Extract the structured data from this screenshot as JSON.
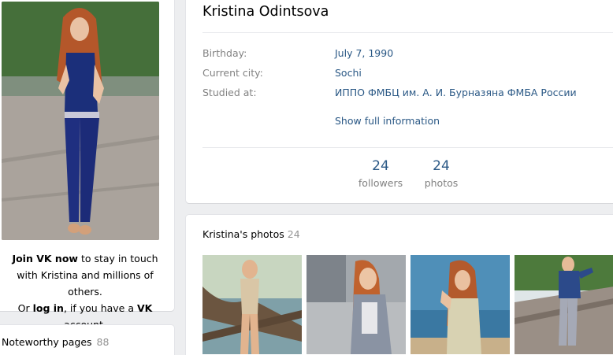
{
  "profile": {
    "name": "Kristina Odintsova",
    "info": [
      {
        "label": "Birthday:",
        "value": "July 7, 1990"
      },
      {
        "label": "Current city:",
        "value": "Sochi"
      },
      {
        "label": "Studied at:",
        "value": "ИППО ФМБЦ им. А. И. Бурназяна ФМБА России"
      }
    ],
    "show_full": "Show full information",
    "counters": [
      {
        "number": "24",
        "label": "followers"
      },
      {
        "number": "24",
        "label": "photos"
      }
    ]
  },
  "join": {
    "part1_bold": "Join VK now",
    "part1_rest": " to stay in touch with Kristina and millions of others.",
    "part2_prefix": "Or ",
    "part2_link": "log in",
    "part2_mid": ", if you have a ",
    "part2_brand": "VK",
    "part2_suffix": " account."
  },
  "noteworthy": {
    "title": "Noteworthy pages",
    "count": "88"
  },
  "photos": {
    "title": "Kristina's photos",
    "count": "24"
  },
  "colors": {
    "link": "#2a5885",
    "label": "#828282",
    "background": "#edeef0"
  }
}
